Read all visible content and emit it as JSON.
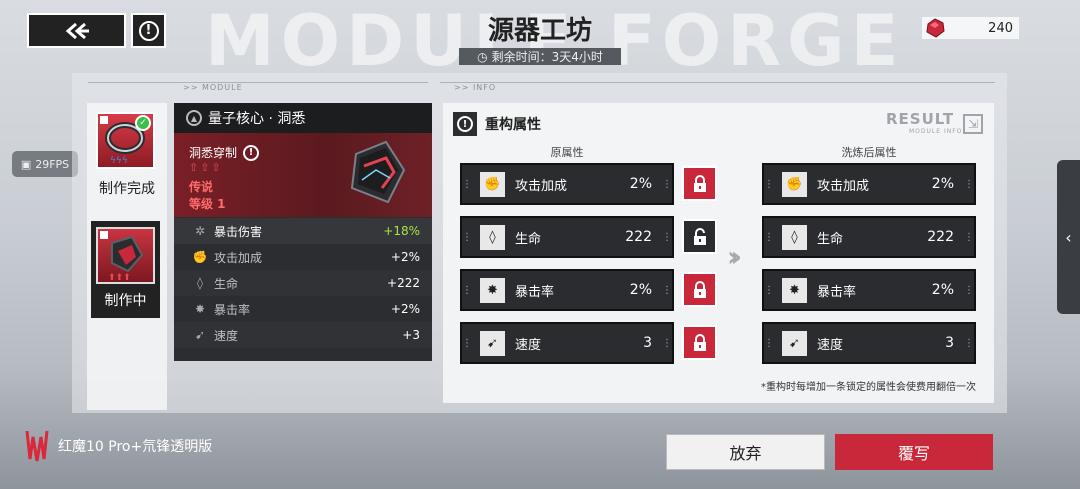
{
  "header": {
    "watermark": "MODULE FORGE",
    "title": "源器工坊",
    "timer_label": "剩余时间：3天4小时",
    "currency_value": "240"
  },
  "fps": "29FPS",
  "sections": {
    "module": ">> MODULE",
    "info": ">> INFO"
  },
  "left_slots": [
    {
      "label": "制作完成"
    },
    {
      "label": "制作中"
    }
  ],
  "module": {
    "name": "量子核心 · 洞悉",
    "skill": "洞悉穿制",
    "rarity": "传说",
    "level": "等级 1",
    "stats": [
      {
        "icon": "gear-icon",
        "glyph": "✲",
        "name": "暴击伤害",
        "value": "+18%"
      },
      {
        "icon": "fist-icon",
        "glyph": "✊",
        "name": "攻击加成",
        "value": "+2%"
      },
      {
        "icon": "drop-icon",
        "glyph": "◊",
        "name": "生命",
        "value": "+222"
      },
      {
        "icon": "burst-icon",
        "glyph": "✸",
        "name": "暴击率",
        "value": "+2%"
      },
      {
        "icon": "boot-icon",
        "glyph": "➹",
        "name": "速度",
        "value": "+3"
      }
    ]
  },
  "info": {
    "title": "重构属性",
    "result": "RESULT",
    "result_sub": "MODULE INFO",
    "original_header": "原属性",
    "after_header": "洗炼后属性",
    "original": [
      {
        "icon": "fist-icon",
        "glyph": "✊",
        "name": "攻击加成",
        "value": "2%",
        "lock": "red"
      },
      {
        "icon": "drop-icon",
        "glyph": "◊",
        "name": "生命",
        "value": "222",
        "lock": "dark"
      },
      {
        "icon": "burst-icon",
        "glyph": "✸",
        "name": "暴击率",
        "value": "2%",
        "lock": "red"
      },
      {
        "icon": "boot-icon",
        "glyph": "➹",
        "name": "速度",
        "value": "3",
        "lock": "red"
      }
    ],
    "after": [
      {
        "icon": "fist-icon",
        "glyph": "✊",
        "name": "攻击加成",
        "value": "2%"
      },
      {
        "icon": "drop-icon",
        "glyph": "◊",
        "name": "生命",
        "value": "222"
      },
      {
        "icon": "burst-icon",
        "glyph": "✸",
        "name": "暴击率",
        "value": "2%"
      },
      {
        "icon": "boot-icon",
        "glyph": "➹",
        "name": "速度",
        "value": "3"
      }
    ],
    "note": "*重构时每增加一条锁定的属性会使费用翻倍一次"
  },
  "actions": {
    "abandon": "放弃",
    "rewrite": "覆写"
  },
  "brand": "红魔10 Pro+氘锋透明版",
  "colors": {
    "accent_red": "#c8283a",
    "panel_dark": "#2b2d30",
    "highlight_green": "#a6e34a"
  }
}
